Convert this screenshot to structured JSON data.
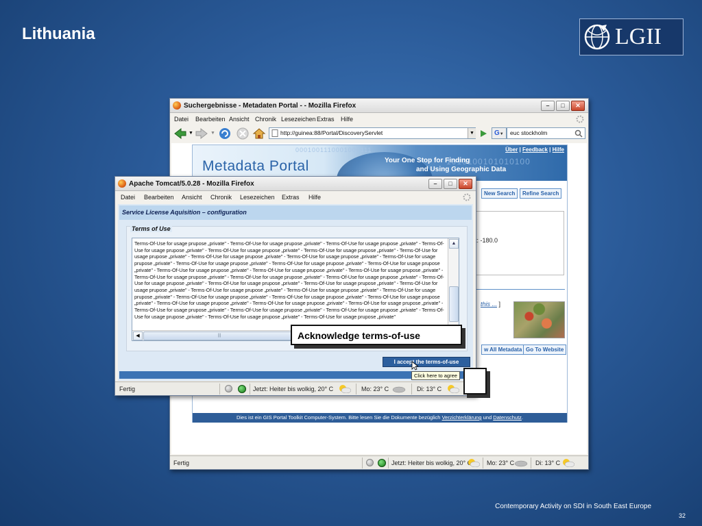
{
  "slide": {
    "title": "Lithuania",
    "logo_text": "LGII",
    "footer": "Contemporary Activity on SDI in South East Europe",
    "page_number": "32"
  },
  "main_window": {
    "title": "Suchergebnisse - Metadaten Portal - - Mozilla Firefox",
    "menu": [
      "Datei",
      "Bearbeiten",
      "Ansicht",
      "Chronik",
      "Lesezeichen",
      "Extras",
      "Hilfe"
    ],
    "url": "http://guinea:88/Portal/DiscoveryServlet",
    "search_value": "euc stockholm",
    "search_engine_glyph": "G",
    "portal": {
      "banner_title": "Metadata Portal",
      "tagline_1": "Your One Stop for Finding",
      "tagline_2": "and Using Geographic Data",
      "binary_1": "0001001110001000111",
      "binary_2": "1010100101010100",
      "top_links": [
        "Über",
        "Feedback",
        "Hilfe"
      ],
      "top_link_sep": "|",
      "new_search": "New Search",
      "refine_search": "Refine Search",
      "coord_text": "t: -180.0",
      "this_link": "this ...",
      "this_link_bracket": "]",
      "view_metadata": "w All Metadata",
      "go_website": "Go To Website",
      "footer_prefix": "Dies ist ein GIS Portal Toolkit Computer-System. Bitte lesen Sie die Dokumente bezüglich",
      "footer_link_1": "Verzichterklärung",
      "footer_mid": "und",
      "footer_link_2": "Datenschutz",
      "footer_end": "."
    },
    "status": {
      "left": "Fertig",
      "now_weather": "Jetzt: Heiter bis wolkig, 20° C",
      "mo_weather": "Mo: 23° C",
      "di_weather": "Di: 13° C"
    }
  },
  "tomcat_window": {
    "title": "Apache Tomcat/5.0.28 - Mozilla Firefox",
    "menu": [
      "Datei",
      "Bearbeiten",
      "Ansicht",
      "Chronik",
      "Lesezeichen",
      "Extras",
      "Hilfe"
    ],
    "heading": "Service License Aquisition – configuration",
    "terms_legend": "Terms of Use",
    "terms_text": "Terms-Of-Use for usage prupose „private\" - Terms-Of-Use for usage prupose „private\" - Terms-Of-Use for usage prupose „private\" - Terms-Of-Use for usage prupose „private\" - Terms-Of-Use for usage prupose „private\" - Terms-Of-Use for usage prupose „private\" - Terms-Of-Use for usage prupose „private\" - Terms-Of-Use for usage prupose „private\" - Terms-Of-Use for usage prupose „private\" - Terms-Of-Use for usage prupose „private\" - Terms-Of-Use for usage prupose „private\" - Terms-Of-Use for usage prupose „private\" - Terms-Of-Use for usage prupose „private\" - Terms-Of-Use for usage prupose „private\" - Terms-Of-Use for usage prupose „private\" - Terms-Of-Use for usage prupose „private\" - Terms-Of-Use for usage prupose „private\" - Terms-Of-Use for usage prupose „private\" - Terms-Of-Use for usage prupose „private\" - Terms-Of-Use for usage prupose „private\" - Terms-Of-Use for usage prupose „private\" - Terms-Of-Use for usage prupose „private\" - Terms-Of-Use for usage prupose „private\" - Terms-Of-Use for usage prupose „private\" - Terms-Of-Use for usage prupose „private\" - Terms-Of-Use for usage prupose „private\" - Terms-Of-Use for usage prupose „private\" - Terms-Of-Use for usage prupose „private\" - Terms-Of-Use for usage prupose „private\" - Terms-Of-Use for usage prupose „private\" - Terms-Of-Use for usage prupose „private\" - Terms-Of-Use for usage prupose „private\" - Terms-Of-Use for usage prupose „private\" - Terms-Of-Use for usage prupose „private\" - Terms-Of-Use for usage prupose „private\" - Terms-Of-Use for usage prupose „private\" - Terms-Of-Use for usage prupose „private\" - Terms-Of-Use for usage prupose „private\"",
    "accept_button": "I accept the terms-of-use",
    "status": {
      "left": "Fertig",
      "now_weather": "Jetzt: Heiter bis wolkig, 20° C",
      "mo_weather": "Mo: 23° C",
      "di_weather": "Di: 13° C"
    }
  },
  "overlays": {
    "callout": "Acknowledge terms-of-use",
    "tooltip": "Click here to agree"
  },
  "colors": {
    "slide_bg": "#2a5a98",
    "portal_blue": "#2e5d98",
    "accept_button": "#2c5f9e",
    "tooltip_bg": "#ffffe1"
  }
}
